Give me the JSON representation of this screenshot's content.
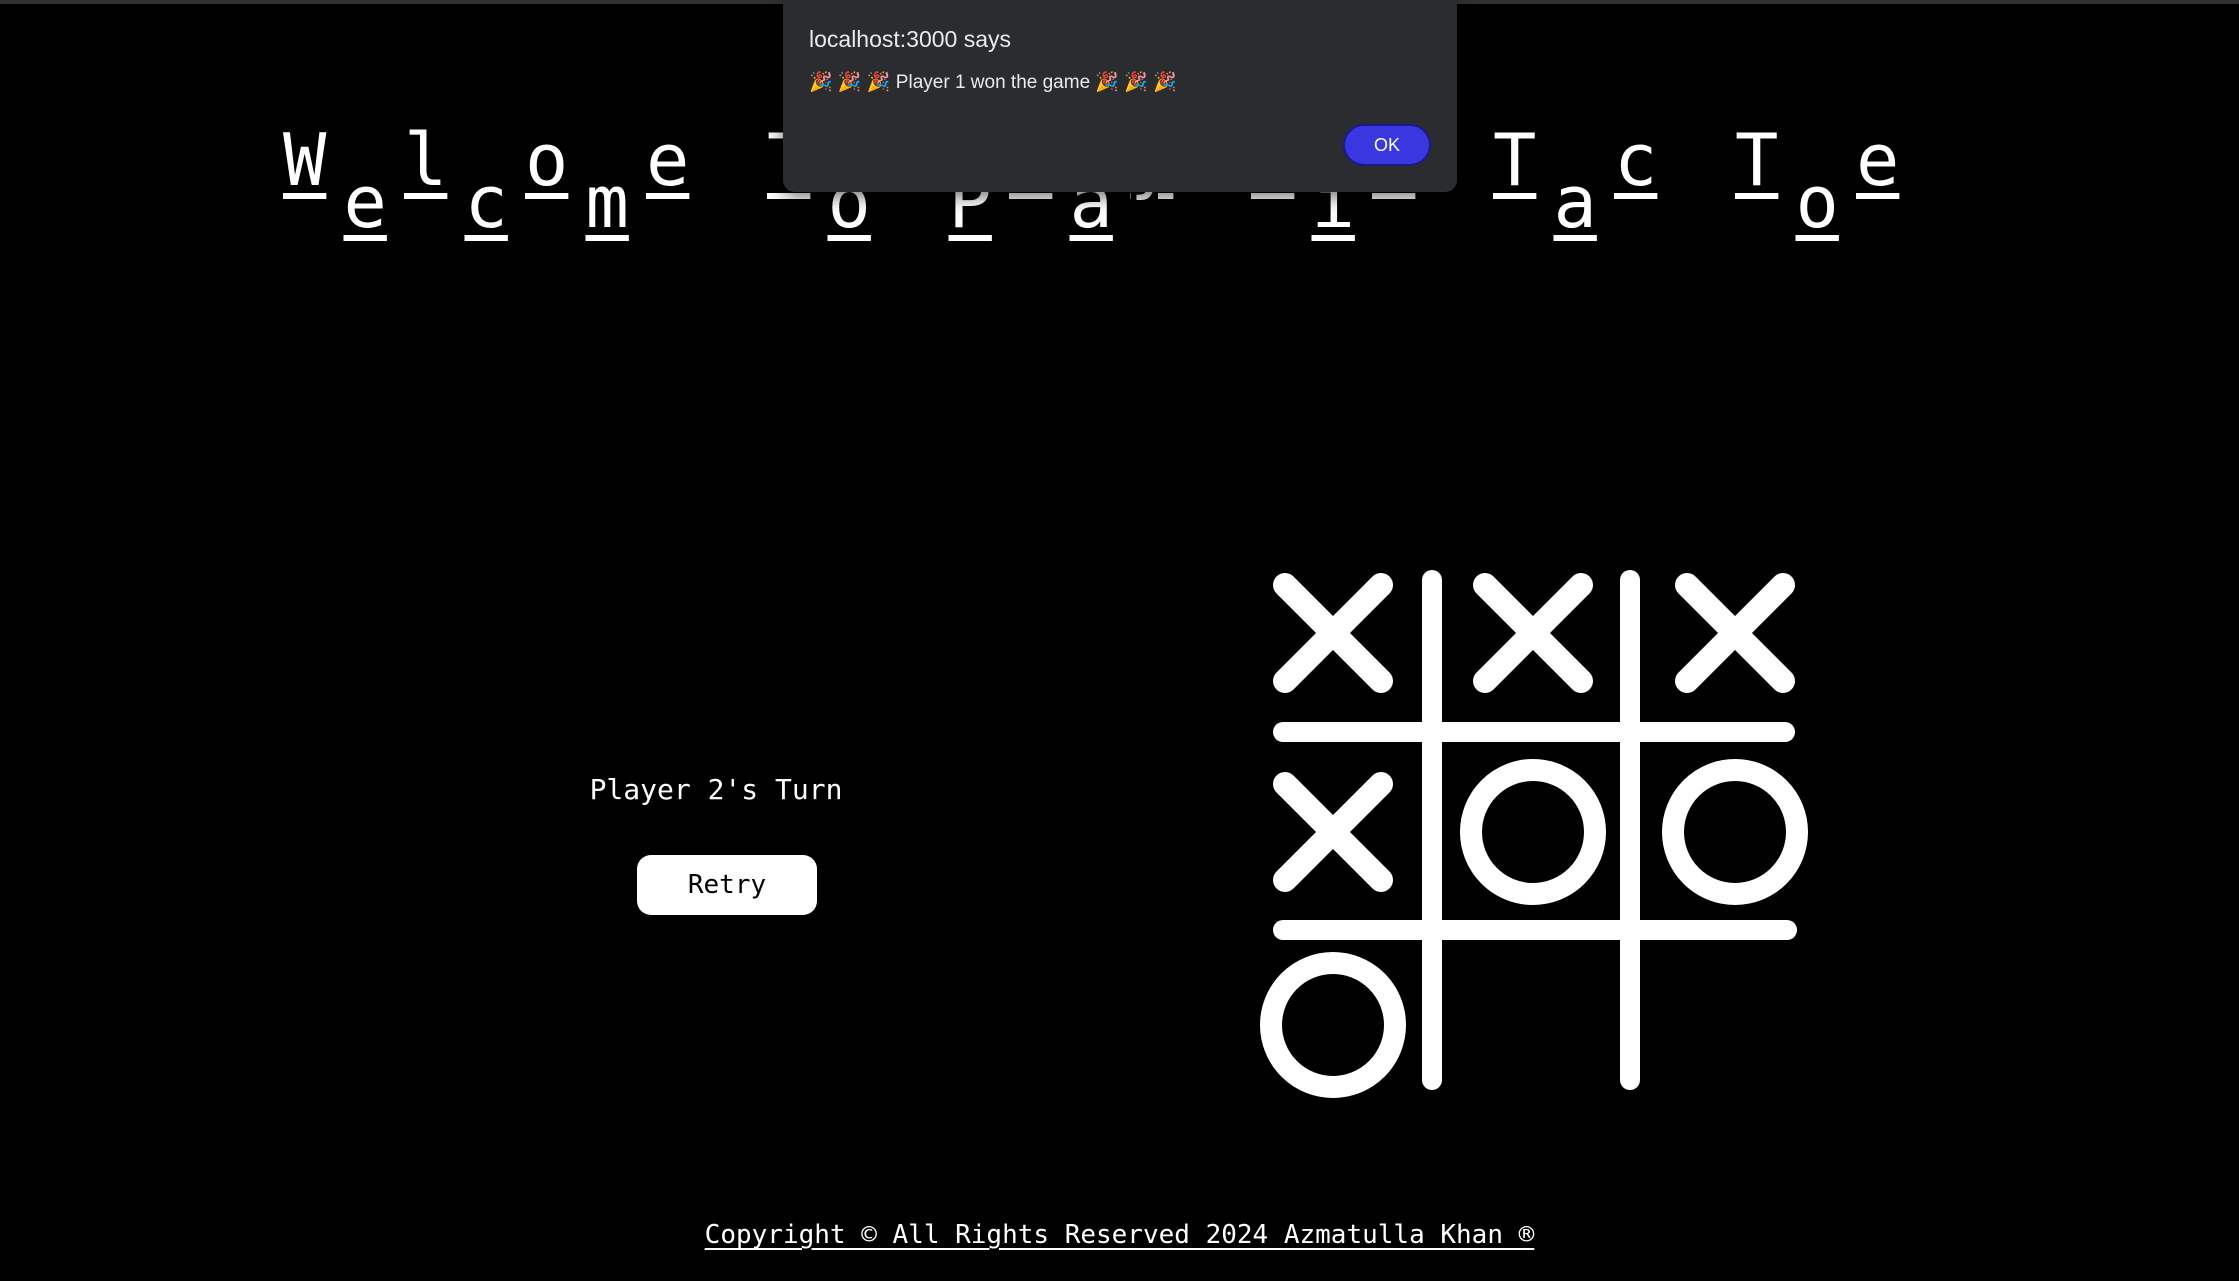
{
  "title": {
    "text": "Welcome To Play Tic Tac Toe"
  },
  "status": {
    "turn_text": "Player 2's Turn"
  },
  "controls": {
    "retry_label": "Retry"
  },
  "board": {
    "cells": [
      "X",
      "X",
      "X",
      "X",
      "O",
      "O",
      "O",
      "",
      ""
    ]
  },
  "footer": {
    "text": "Copyright © All Rights Reserved 2024 Azmatulla Khan ®"
  },
  "alert": {
    "origin": "localhost:3000 says",
    "message": "🎉 🎉 🎉 Player 1 won the game 🎉 🎉 🎉",
    "ok_label": "OK"
  },
  "colors": {
    "background": "#000000",
    "foreground": "#ffffff",
    "dialog_bg": "#2b2c2f",
    "ok_button": "#3a37e0"
  }
}
